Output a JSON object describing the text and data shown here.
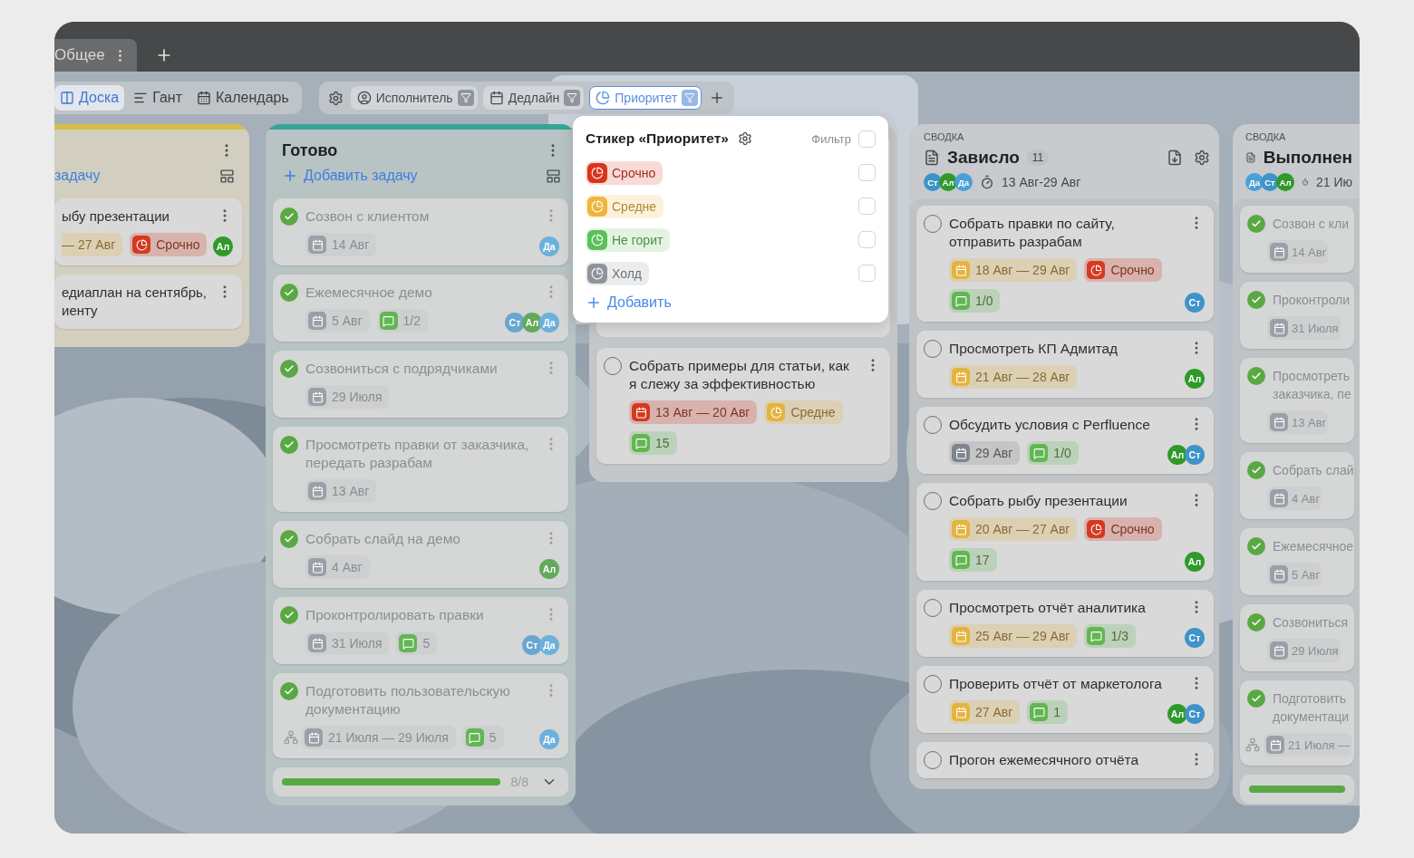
{
  "tabs": [
    {
      "label": "Общее",
      "selected": true
    }
  ],
  "views": [
    {
      "kind": "board",
      "label": "Доска",
      "selected": true
    },
    {
      "kind": "gantt",
      "label": "Гант",
      "selected": false
    },
    {
      "kind": "calendar",
      "label": "Календарь",
      "selected": false
    }
  ],
  "filters": [
    {
      "kind": "person",
      "label": "Исполнитель",
      "selected": false
    },
    {
      "kind": "deadline",
      "label": "Дедлайн",
      "selected": false
    },
    {
      "kind": "priority",
      "label": "Приоритет",
      "selected": true
    }
  ],
  "popover": {
    "title": "Стикер «Приоритет»",
    "filter_label": "Фильтр",
    "filter_checked": false,
    "add_label": "Добавить",
    "options": [
      {
        "label": "Срочно",
        "color": "#d9341c",
        "checked": false
      },
      {
        "label": "Средне",
        "color": "#efb53c",
        "checked": false
      },
      {
        "label": "Не горит",
        "color": "#5cc05a",
        "checked": false
      },
      {
        "label": "Холд",
        "color": "#8f949c",
        "checked": false
      }
    ]
  },
  "columns": [
    {
      "kind": "list",
      "color": "#d9bf4a",
      "add_label": "задачу",
      "cards": [
        {
          "title": "ыбу презентации",
          "tags": [
            {
              "kind": "date_tail",
              "text": "— 27 Авг"
            },
            {
              "kind": "priority",
              "text": "Срочно",
              "color": "#d43a20"
            }
          ],
          "avatars": [
            {
              "initials": "Ал",
              "color": "#2f9a2a"
            }
          ]
        },
        {
          "title": "едиаплан на сентябрь, иенту"
        }
      ]
    },
    {
      "kind": "list",
      "color": "#35a597",
      "title": "Готово",
      "add_label": "Добавить задачу",
      "cards": [
        {
          "title": "Созвон с клиентом",
          "done": true,
          "tags": [
            {
              "kind": "date",
              "text": "14 Авг",
              "color": "#9aa0a7"
            }
          ],
          "avatars": [
            {
              "initials": "Да",
              "color": "#6cb0dc"
            }
          ]
        },
        {
          "title": "Ежемесячное демо",
          "done": true,
          "tags": [
            {
              "kind": "date",
              "text": "5 Авг",
              "color": "#9aa0a7"
            },
            {
              "kind": "comments",
              "text": "1/2"
            }
          ],
          "avatars": [
            {
              "initials": "Ст",
              "color": "#6aa6cf"
            },
            {
              "initials": "Ал",
              "color": "#63a95a"
            },
            {
              "initials": "Да",
              "color": "#6cb0dc"
            }
          ]
        },
        {
          "title": "Созвониться с подрядчиками",
          "done": true,
          "tags": [
            {
              "kind": "date",
              "text": "29 Июля",
              "color": "#9aa0a7"
            }
          ]
        },
        {
          "title": "Просмотреть правки от заказчика, передать разрабам",
          "done": true,
          "tags": [
            {
              "kind": "date",
              "text": "13 Авг",
              "color": "#9aa0a7"
            }
          ]
        },
        {
          "title": "Собрать слайд на демо",
          "done": true,
          "tags": [
            {
              "kind": "date",
              "text": "4 Авг",
              "color": "#9aa0a7"
            }
          ],
          "avatars": [
            {
              "initials": "Ал",
              "color": "#63a95a"
            }
          ]
        },
        {
          "title": "Проконтролировать правки",
          "done": true,
          "tags": [
            {
              "kind": "date",
              "text": "31 Июля",
              "color": "#9aa0a7"
            },
            {
              "kind": "comments",
              "text": "5"
            }
          ],
          "avatars": [
            {
              "initials": "Ст",
              "color": "#6aa6cf"
            },
            {
              "initials": "Да",
              "color": "#6cb0dc"
            }
          ]
        },
        {
          "title": "Подготовить пользовательскую документацию",
          "done": true,
          "subtasks": true,
          "tags": [
            {
              "kind": "date",
              "text": "21 Июля — 29 Июля",
              "color": "#9aa0a7"
            },
            {
              "kind": "comments",
              "text": "5"
            }
          ],
          "avatars": [
            {
              "initials": "Да",
              "color": "#6cb0dc"
            }
          ]
        }
      ],
      "progress": {
        "level": 1,
        "text": "8/8"
      }
    },
    {
      "kind": "covered",
      "cards": [
        {
          "title": "Собрать примеры для статьи, как я слежу за эффективностью",
          "done": false,
          "tags": [
            {
              "kind": "date",
              "text": "13 Авг — 20 Авг",
              "color": "#d43a20"
            },
            {
              "kind": "priority",
              "text": "Средне",
              "color": "#e5b33f"
            },
            {
              "kind": "comments",
              "text": "15"
            }
          ]
        }
      ]
    },
    {
      "kind": "summary",
      "label": "СВОДКА",
      "title": "Зависло",
      "count": "11",
      "period": "13 Авг-29 Авг",
      "avatars": [
        {
          "initials": "Ст",
          "color": "#3e93c9"
        },
        {
          "initials": "Ал",
          "color": "#2f9a2a"
        },
        {
          "initials": "Да",
          "color": "#4a9fd6"
        }
      ],
      "cards": [
        {
          "title": "Собрать правки по сайту, отправить разрабам",
          "done": false,
          "tags": [
            {
              "kind": "date",
              "text": "18 Авг — 29 Авг",
              "color": "#e5b33f"
            },
            {
              "kind": "priority",
              "text": "Срочно",
              "color": "#d43a20"
            },
            {
              "kind": "comments",
              "text": "1/0"
            }
          ],
          "avatars": [
            {
              "initials": "Ст",
              "color": "#3e93c9"
            }
          ]
        },
        {
          "title": "Просмотреть КП Адмитад",
          "done": false,
          "tags": [
            {
              "kind": "date",
              "text": "21 Авг — 28 Авг",
              "color": "#e5b33f"
            }
          ],
          "avatars": [
            {
              "initials": "Ал",
              "color": "#2f9a2a"
            }
          ]
        },
        {
          "title": "Обсудить условия с Perfluence",
          "done": false,
          "tags": [
            {
              "kind": "date",
              "text": "29 Авг",
              "color": "#7f858e"
            },
            {
              "kind": "comments",
              "text": "1/0"
            }
          ],
          "avatars": [
            {
              "initials": "Ал",
              "color": "#2f9a2a"
            },
            {
              "initials": "Ст",
              "color": "#3e93c9"
            }
          ]
        },
        {
          "title": "Собрать рыбу презентации",
          "done": false,
          "tags": [
            {
              "kind": "date",
              "text": "20 Авг — 27 Авг",
              "color": "#e5b33f"
            },
            {
              "kind": "priority",
              "text": "Срочно",
              "color": "#d43a20"
            },
            {
              "kind": "comments",
              "text": "17"
            }
          ],
          "avatars": [
            {
              "initials": "Ал",
              "color": "#2f9a2a"
            }
          ]
        },
        {
          "title": "Просмотреть отчёт аналитика",
          "done": false,
          "tags": [
            {
              "kind": "date",
              "text": "25 Авг — 29 Авг",
              "color": "#e5b33f"
            },
            {
              "kind": "comments",
              "text": "1/3"
            }
          ],
          "avatars": [
            {
              "initials": "Ст",
              "color": "#3e93c9"
            }
          ]
        },
        {
          "title": "Проверить отчёт от маркетолога",
          "done": false,
          "tags": [
            {
              "kind": "date",
              "text": "27 Авг",
              "color": "#e5b33f"
            },
            {
              "kind": "comments",
              "text": "1"
            }
          ],
          "avatars": [
            {
              "initials": "Ал",
              "color": "#2f9a2a"
            },
            {
              "initials": "Ст",
              "color": "#3e93c9"
            }
          ]
        },
        {
          "title": "Прогон ежемесячного отчёта",
          "done": false
        }
      ]
    },
    {
      "kind": "summary",
      "label": "СВОДКА",
      "title": "Выполнен",
      "period": "21 Ию",
      "avatars": [
        {
          "initials": "Да",
          "color": "#4a9fd6"
        },
        {
          "initials": "Ст",
          "color": "#3e93c9"
        },
        {
          "initials": "Ал",
          "color": "#2f9a2a"
        }
      ],
      "cards": [
        {
          "title": "Созвон с кли",
          "done": true,
          "tags": [
            {
              "kind": "date",
              "text": "14 Авг",
              "color": "#9aa0a7"
            }
          ]
        },
        {
          "title": "Проконтроли",
          "done": true,
          "tags": [
            {
              "kind": "date",
              "text": "31 Июля",
              "color": "#9aa0a7"
            }
          ]
        },
        {
          "title": "Просмотреть\nзаказчика, пе",
          "done": true,
          "tags": [
            {
              "kind": "date",
              "text": "13 Авг",
              "color": "#9aa0a7"
            }
          ]
        },
        {
          "title": "Собрать слай",
          "done": true,
          "tags": [
            {
              "kind": "date",
              "text": "4 Авг",
              "color": "#9aa0a7"
            }
          ]
        },
        {
          "title": "Ежемесячное",
          "done": true,
          "tags": [
            {
              "kind": "date",
              "text": "5 Авг",
              "color": "#9aa0a7"
            }
          ]
        },
        {
          "title": "Созвониться",
          "done": true,
          "tags": [
            {
              "kind": "date",
              "text": "29 Июля",
              "color": "#9aa0a7"
            }
          ]
        },
        {
          "title": "Подготовить\nдокументаци",
          "done": true,
          "subtasks": true,
          "tags": [
            {
              "kind": "date",
              "text": "21 Июля —",
              "color": "#9aa0a7"
            }
          ]
        }
      ],
      "progress": {
        "level": 1
      }
    }
  ]
}
